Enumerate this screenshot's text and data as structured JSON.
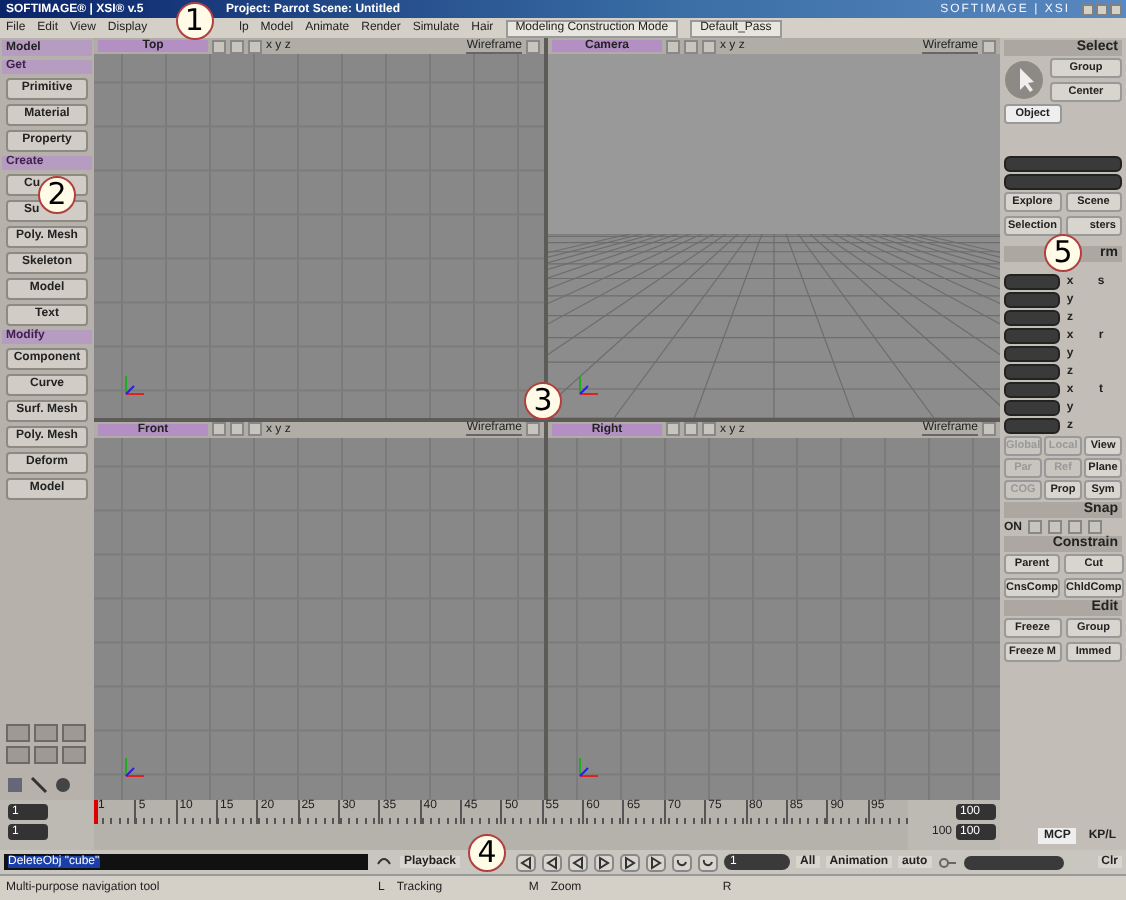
{
  "window": {
    "app": "SOFTIMAGE® | XSI® v.5",
    "project": "Project: Parrot    Scene: Untitled",
    "brand": "SOFTIMAGE | XSI"
  },
  "menu": [
    "File",
    "Edit",
    "View",
    "Display",
    "lp",
    "Model",
    "Animate",
    "Render",
    "Simulate",
    "Hair"
  ],
  "layout_dropdown": "Modeling Construction Mode",
  "pass_dropdown": "Default_Pass",
  "left_panel": {
    "mode": "Model",
    "sections": [
      {
        "title": "Get",
        "buttons": [
          "Primitive",
          "Material",
          "Property"
        ]
      },
      {
        "title": "Create",
        "buttons": [
          "Cu",
          "Su",
          "Poly. Mesh",
          "Skeleton",
          "Model",
          "Text"
        ]
      },
      {
        "title": "Modify",
        "buttons": [
          "Component",
          "Curve",
          "Surf. Mesh",
          "Poly. Mesh",
          "Deform",
          "Model"
        ]
      }
    ]
  },
  "viewports": [
    {
      "view": "Top",
      "kind": "ortho",
      "axes": "x y z",
      "mode": "Wireframe"
    },
    {
      "view": "Camera",
      "kind": "perspective",
      "axes": "x y z",
      "mode": "Wireframe"
    },
    {
      "view": "Front",
      "kind": "ortho",
      "axes": "x y z",
      "mode": "Wireframe"
    },
    {
      "view": "Right",
      "kind": "ortho",
      "axes": "x y z",
      "mode": "Wireframe"
    }
  ],
  "right_panel": {
    "select": {
      "title": "Select",
      "buttons": [
        "Group",
        "Center"
      ],
      "filter": "Object",
      "explore": [
        "Explore",
        "Scene"
      ],
      "selection": [
        "Selection",
        "sters"
      ]
    },
    "transform": {
      "title": "rm",
      "groups": [
        {
          "key": "s",
          "axes": [
            "x",
            "y",
            "z"
          ]
        },
        {
          "key": "r",
          "axes": [
            "x",
            "y",
            "z"
          ]
        },
        {
          "key": "t",
          "axes": [
            "x",
            "y",
            "z"
          ]
        }
      ],
      "spaces": [
        {
          "label": "Global",
          "selected": false
        },
        {
          "label": "Local",
          "selected": false
        },
        {
          "label": "View",
          "selected": true
        }
      ],
      "refs": [
        {
          "label": "Par",
          "selected": false
        },
        {
          "label": "Ref",
          "selected": false
        },
        {
          "label": "Plane",
          "selected": true
        }
      ],
      "options": [
        {
          "label": "COG",
          "selected": false
        },
        {
          "label": "Prop",
          "selected": true
        },
        {
          "label": "Sym",
          "selected": true
        }
      ]
    },
    "snap": {
      "title": "Snap",
      "on": "ON"
    },
    "constrain": {
      "title": "Constrain",
      "buttons": [
        "Parent",
        "Cut",
        "CnsComp",
        "ChldComp"
      ]
    },
    "edit": {
      "title": "Edit",
      "buttons": [
        "Freeze",
        "Group",
        "Freeze M",
        "Immed"
      ]
    },
    "tabs": [
      {
        "label": "MCP",
        "selected": true
      },
      {
        "label": "KP/L",
        "selected": false
      }
    ]
  },
  "timeline": {
    "start": "1",
    "current": "1",
    "ticks": [
      "1",
      "5",
      "10",
      "15",
      "20",
      "25",
      "30",
      "35",
      "40",
      "45",
      "50",
      "55",
      "60",
      "65",
      "70",
      "75",
      "80",
      "85",
      "90",
      "95"
    ],
    "end_label": "100",
    "end": [
      "100",
      "100"
    ]
  },
  "command": {
    "script": "DeleteObj \"cube\"",
    "playback": "Playback",
    "frame": "1",
    "all": "All",
    "animation": "Animation",
    "auto": "auto",
    "clear": "Clr"
  },
  "status": {
    "message": "Multi-purpose navigation tool",
    "left": "L",
    "left_action": "Tracking",
    "middle": "M",
    "middle_action": "Zoom",
    "right": "R"
  },
  "callouts": [
    "1",
    "2",
    "3",
    "4",
    "5"
  ]
}
